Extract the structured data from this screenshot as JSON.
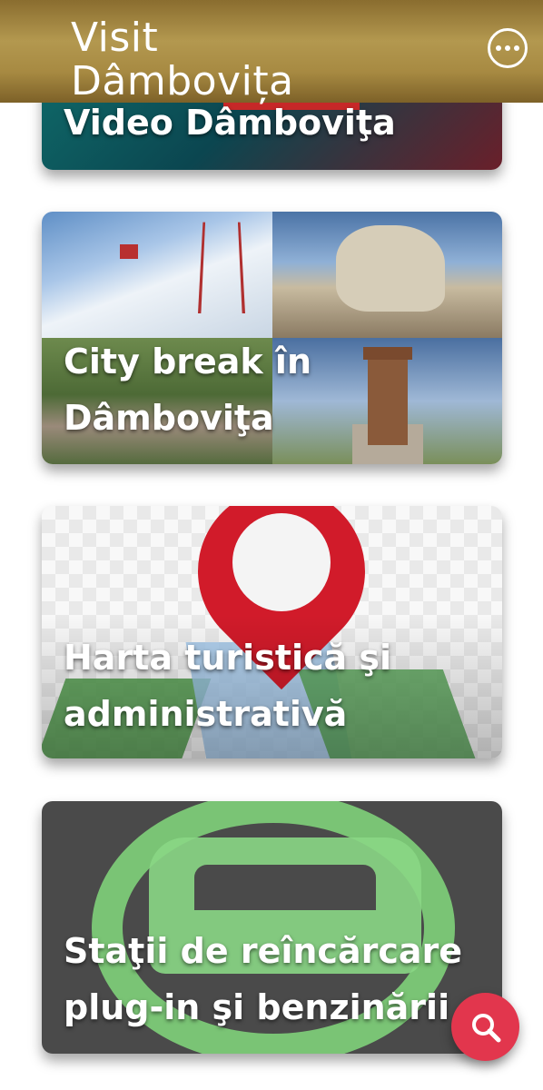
{
  "header": {
    "title_line1": "Visit",
    "title_line2": "Dâmbovița",
    "menu_icon": "more-horizontal-icon"
  },
  "cards": [
    {
      "label_lines": [
        "Video Dâmboviţa"
      ]
    },
    {
      "label_lines": [
        "City break în",
        "Dâmboviţa"
      ]
    },
    {
      "label_lines": [
        "Harta turistică şi",
        "administrativă"
      ]
    },
    {
      "label_lines": [
        "Staţii de reîncărcare",
        "plug-in şi benzinării"
      ]
    }
  ],
  "fab": {
    "icon": "search-icon"
  },
  "colors": {
    "header_gold": "#a78a42",
    "fab_red": "#e2364d",
    "text_white": "#ffffff"
  }
}
